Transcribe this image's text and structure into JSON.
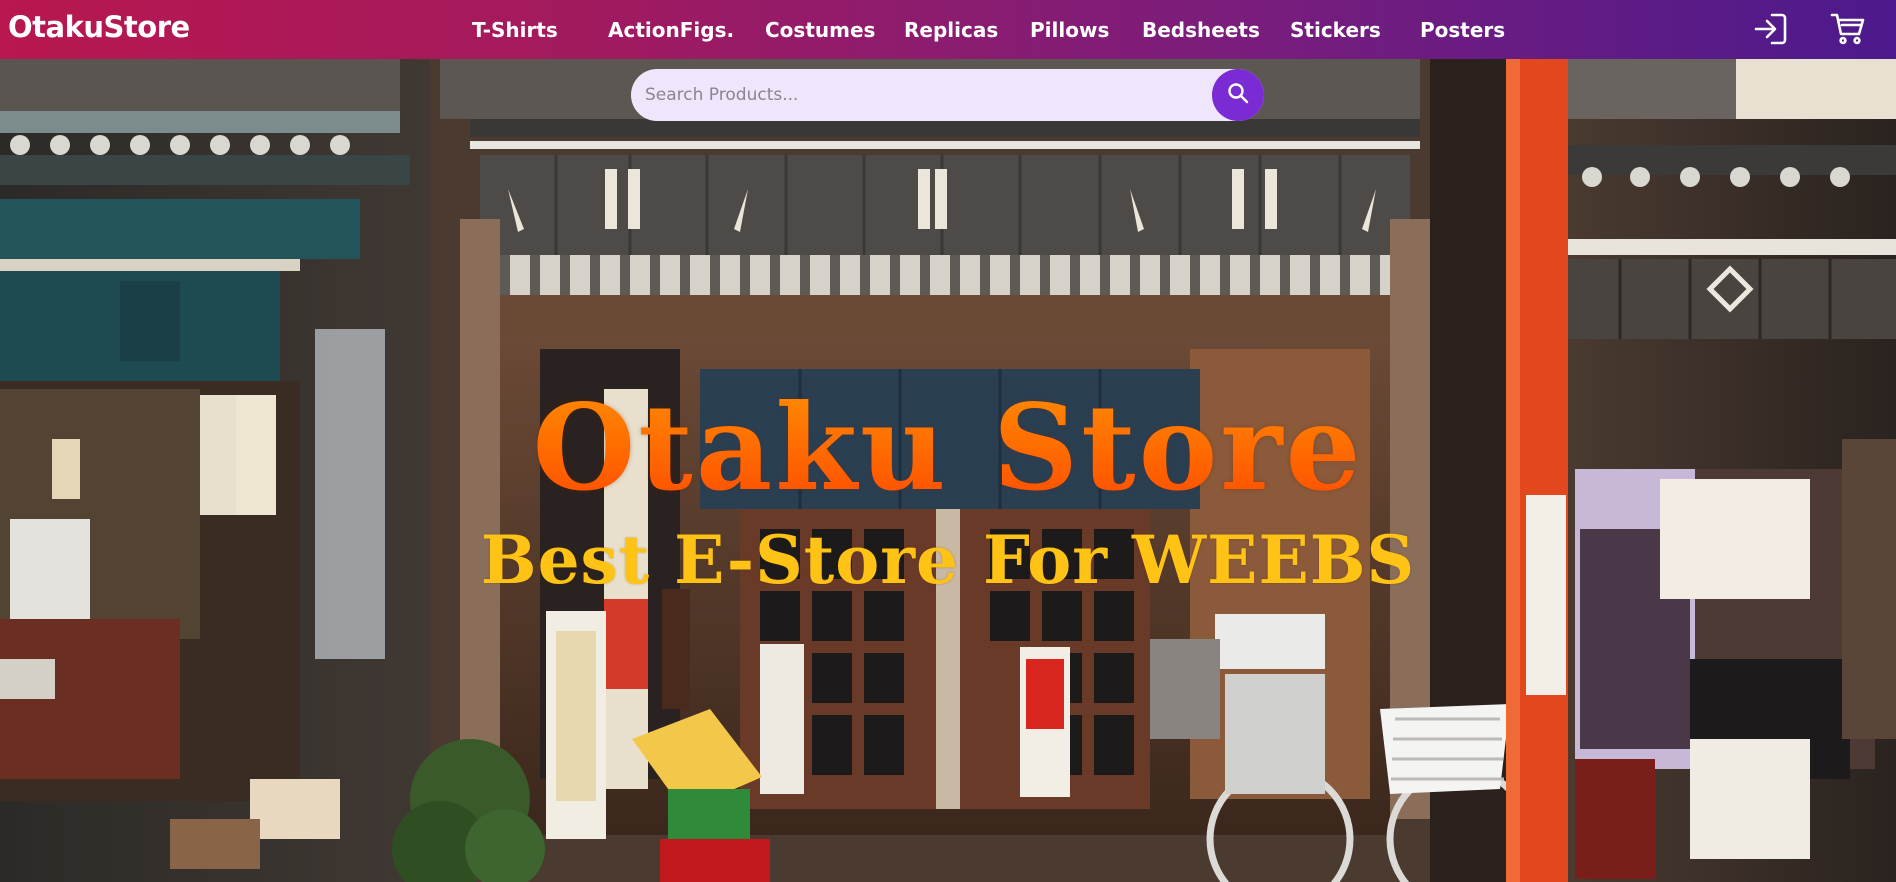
{
  "navbar": {
    "brand": "OtakuStore",
    "links": [
      {
        "label": "T-Shirts"
      },
      {
        "label": "ActionFigs."
      },
      {
        "label": "Costumes"
      },
      {
        "label": "Replicas"
      },
      {
        "label": "Pillows"
      },
      {
        "label": "Bedsheets"
      },
      {
        "label": "Stickers"
      },
      {
        "label": "Posters"
      }
    ],
    "icons": [
      "login-icon",
      "cart-icon"
    ],
    "colors": {
      "gradient_start": "#b8174f",
      "gradient_end": "#4c1a8c"
    }
  },
  "search": {
    "placeholder": "Search Products...",
    "value": "",
    "button_icon": "search-icon",
    "button_color": "#7b2bd4"
  },
  "hero": {
    "title": "Otaku Store",
    "subtitle": "Best E-Store For WEEBS",
    "title_color": "#ff5e00",
    "subtitle_color": "#ffc315"
  }
}
